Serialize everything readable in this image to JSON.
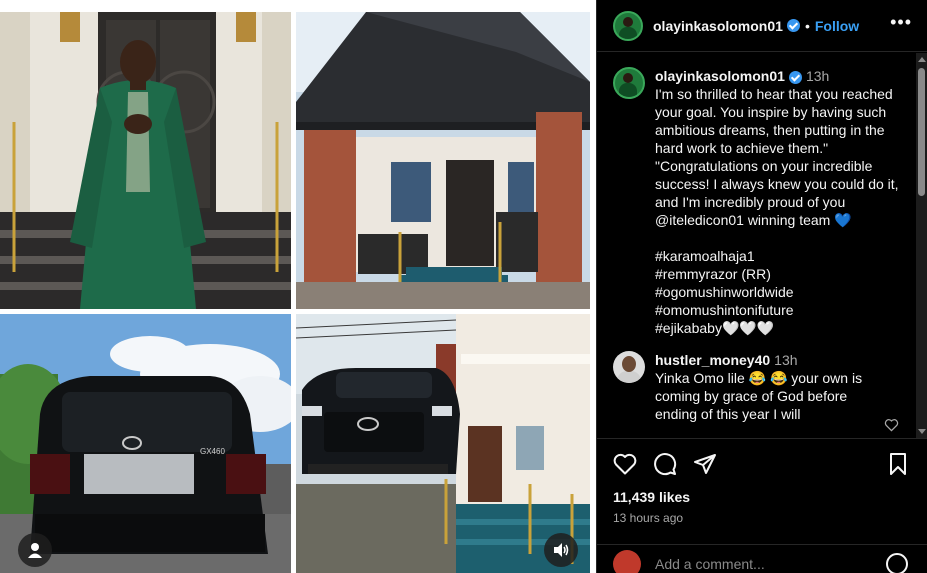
{
  "post": {
    "username": "olayinkasolomon01",
    "follow_label": "Follow",
    "more_label": "•••"
  },
  "media": {
    "photos": [
      {
        "name": "man-in-green-agbada-photo"
      },
      {
        "name": "bungalow-house-photo"
      },
      {
        "name": "lexus-suv-rear-photo"
      },
      {
        "name": "lexus-suv-front-and-entrance-photo"
      }
    ],
    "car_badge": "GX460"
  },
  "comments": [
    {
      "author": "olayinkasolomon01",
      "time": "13h",
      "verified": true,
      "lines": [
        "I'm so thrilled to hear that you reached",
        "your goal. You inspire by having such",
        "ambitious dreams, then putting in the",
        "hard work to achieve them.\"",
        "\"Congratulations on your incredible",
        "success! I always knew you could do it,",
        "and I'm incredibly proud of you",
        "@iteledicon01 winning team 💙"
      ],
      "hashtags": [
        "#karamoalhaja1",
        "#remmyrazor (RR)",
        "#ogomushinworldwide",
        "#omomushintonifuture",
        "#ejikababy🤍🤍🤍"
      ]
    },
    {
      "author": "hustler_money40",
      "time": "13h",
      "verified": false,
      "lines": [
        "Yinka Omo lile 😂 😂 your own is",
        "coming by grace of God before",
        "ending of this year I will"
      ]
    }
  ],
  "stats": {
    "likes": "11,439 likes",
    "time_ago": "13 hours ago"
  },
  "composer": {
    "placeholder": "Add a comment..."
  },
  "colors": {
    "accent": "#3aa0f5",
    "verified": "#3897f0",
    "background": "#000000"
  }
}
